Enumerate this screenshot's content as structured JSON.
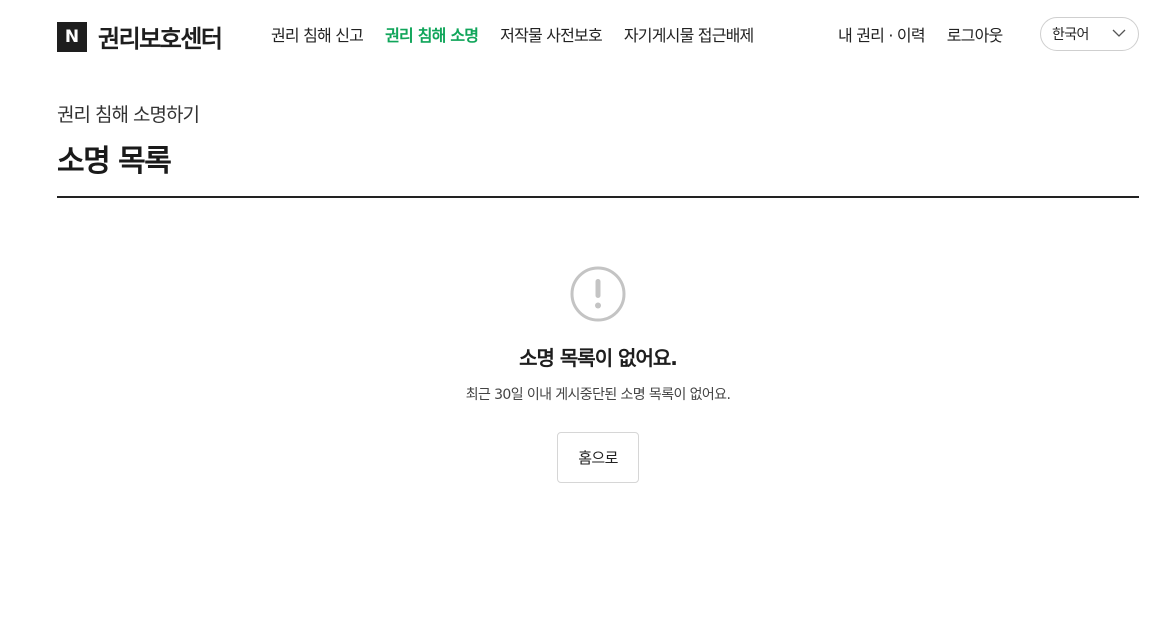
{
  "header": {
    "logo_mark": "N",
    "logo_text": "권리보호센터",
    "nav_main": [
      {
        "label": "권리 침해 신고"
      },
      {
        "label": "권리 침해 소명",
        "active": true
      },
      {
        "label": "저작물 사전보호"
      },
      {
        "label": "자기게시물 접근배제"
      }
    ],
    "nav_util": [
      {
        "label": "내 권리 · 이력"
      },
      {
        "label": "로그아웃"
      }
    ],
    "language": {
      "selected": "한국어",
      "icon": "chevron-down-icon"
    }
  },
  "page": {
    "breadcrumb": "권리 침해 소명하기",
    "title": "소명 목록"
  },
  "empty_state": {
    "icon": "alert-circle-icon",
    "title": "소명 목록이 없어요.",
    "description": "최근 30일 이내 게시중단된 소명 목록이 없어요.",
    "button_label": "홈으로"
  },
  "colors": {
    "accent": "#10a55a",
    "text": "#222222",
    "icon_gray": "#c4c4c4",
    "border": "#d6d6d6"
  }
}
